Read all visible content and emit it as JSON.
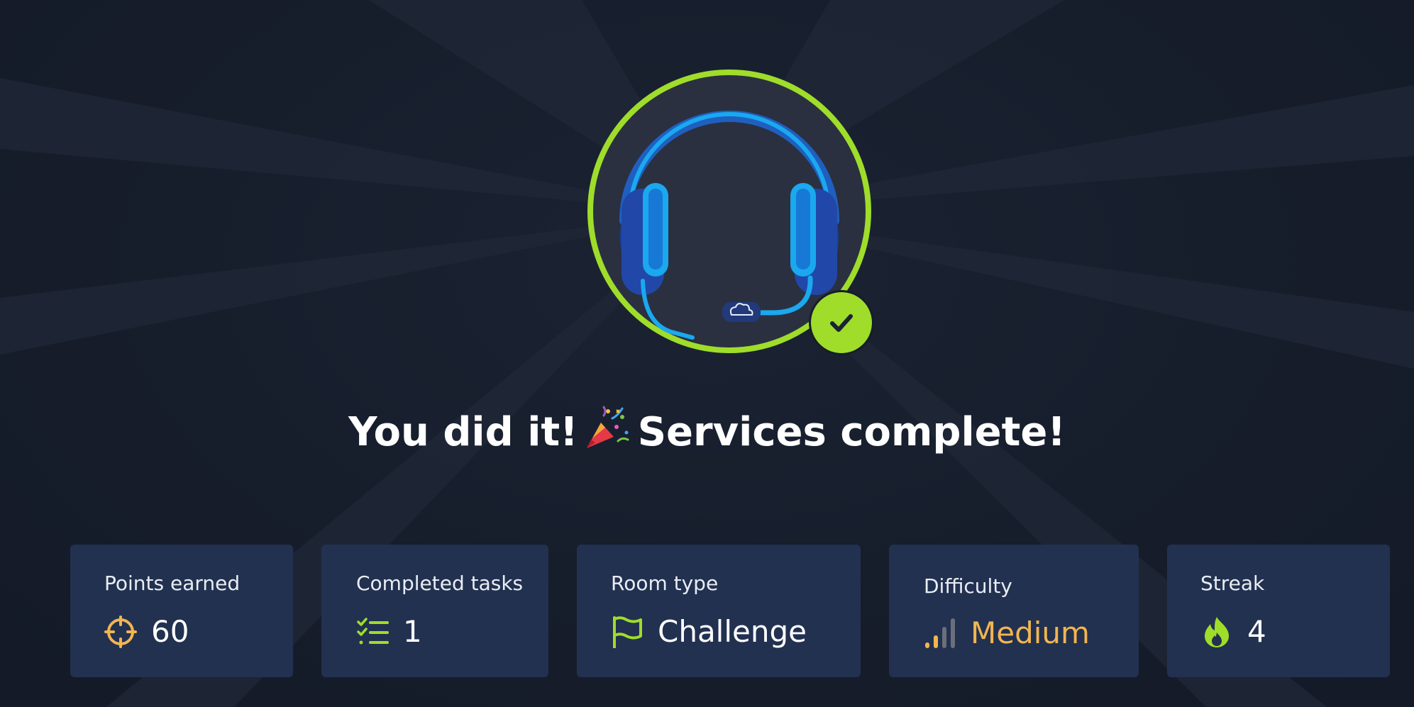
{
  "colors": {
    "accent_green": "#9fdd2a",
    "headphone_blue": "#1aa8ef",
    "card_bg": "#223150",
    "points_orange": "#f2b550",
    "difficulty_orange": "#f2b550"
  },
  "hero": {
    "badge_icon": "headset-badge-icon",
    "completed_icon": "checkmark-icon",
    "headline_prefix": "You did it!",
    "headline_emoji": "party-popper-icon",
    "headline_suffix": "Services complete!"
  },
  "stats": [
    {
      "label": "Points earned",
      "icon": "crosshair-icon",
      "value": "60"
    },
    {
      "label": "Completed tasks",
      "icon": "checklist-icon",
      "value": "1"
    },
    {
      "label": "Room type",
      "icon": "flag-icon",
      "value": "Challenge"
    },
    {
      "label": "Difficulty",
      "icon": "signal-bars-icon",
      "value": "Medium"
    },
    {
      "label": "Streak",
      "icon": "flame-icon",
      "value": "4"
    }
  ]
}
